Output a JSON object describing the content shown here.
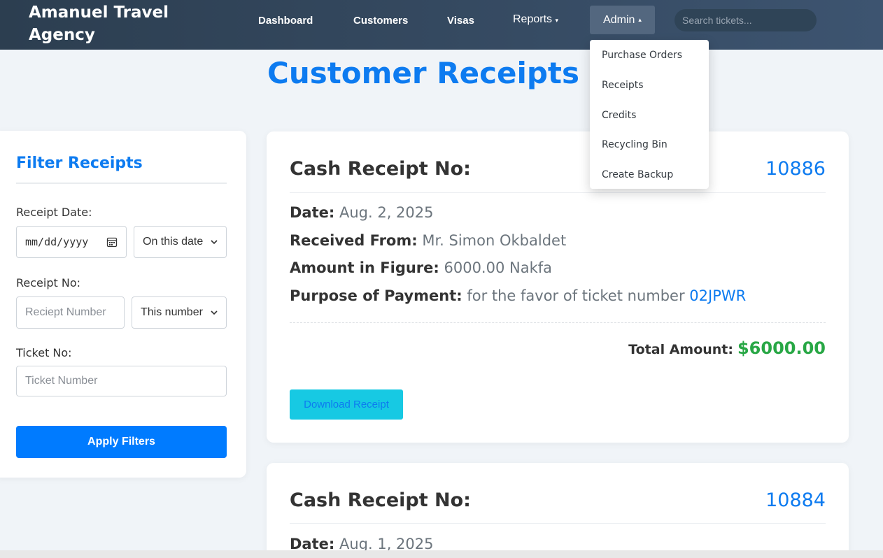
{
  "navbar": {
    "brand": "Amanuel Travel Agency",
    "links": [
      "Dashboard",
      "Customers",
      "Visas"
    ],
    "reports": "Reports",
    "reports_caret": "▾",
    "admin": "Admin",
    "admin_caret": "▴",
    "search_placeholder": "Search tickets..."
  },
  "page_title": "Customer Receipts",
  "admin_menu": [
    "Purchase Orders",
    "Receipts",
    "Credits",
    "Recycling Bin",
    "Create Backup"
  ],
  "filters": {
    "title": "Filter Receipts",
    "date_label": "Receipt Date:",
    "date_value": "mm/dd/yyyy",
    "date_mode": "On this date",
    "receipt_label": "Receipt No:",
    "receipt_placeholder": "Reciept Number",
    "receipt_mode": "This number",
    "ticket_label": "Ticket No:",
    "ticket_placeholder": "Ticket Number",
    "apply": "Apply Filters"
  },
  "receipts": [
    {
      "heading": "Cash Receipt No:",
      "number": "10886",
      "date_label": "Date:",
      "date": "Aug. 2, 2025",
      "from_label": "Received From:",
      "from": "Mr. Simon Okbaldet",
      "amount_label": "Amount in Figure:",
      "amount": "6000.00 Nakfa",
      "purpose_label": "Purpose of Payment:",
      "purpose": "for the favor of ticket number",
      "ticket": "02JPWR",
      "total_label": "Total Amount:",
      "total": "$6000.00",
      "download": "Download Receipt"
    },
    {
      "heading": "Cash Receipt No:",
      "number": "10884",
      "date_label": "Date:",
      "date": "Aug. 1, 2025"
    }
  ]
}
